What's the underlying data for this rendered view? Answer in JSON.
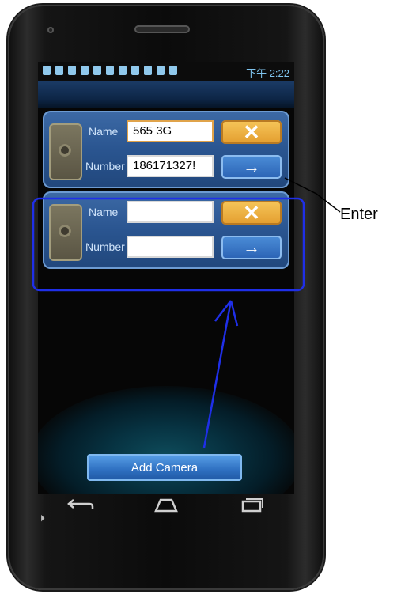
{
  "status_bar": {
    "time": "下午 2:22",
    "icons": [
      "usb-icon",
      "usb-debug-icon",
      "image-icon",
      "shield-icon",
      "moon-icon",
      "usb-bar-icon",
      "sd-icon",
      "chat-icon",
      "alarm-icon",
      "signal-icon",
      "battery-icon"
    ]
  },
  "cards": [
    {
      "name_label": "Name",
      "name_value": "565 3G",
      "number_label": "Number",
      "number_value": "186171327!",
      "delete_symbol": "✕",
      "enter_symbol": "→"
    },
    {
      "name_label": "Name",
      "name_value": "",
      "number_label": "Number",
      "number_value": "",
      "delete_symbol": "✕",
      "enter_symbol": "→"
    }
  ],
  "add_camera_label": "Add Camera",
  "annotation": {
    "enter_label": "Enter"
  },
  "nav": {
    "back_icon": "back-icon",
    "home_icon": "home-icon",
    "recent_icon": "recent-apps-icon"
  },
  "colors": {
    "card_blue": "#2a5590",
    "delete_orange": "#e39d2e",
    "enter_blue": "#2a62b4",
    "highlight_box": "#1f2fe8",
    "status_text": "#7fc4ee"
  }
}
